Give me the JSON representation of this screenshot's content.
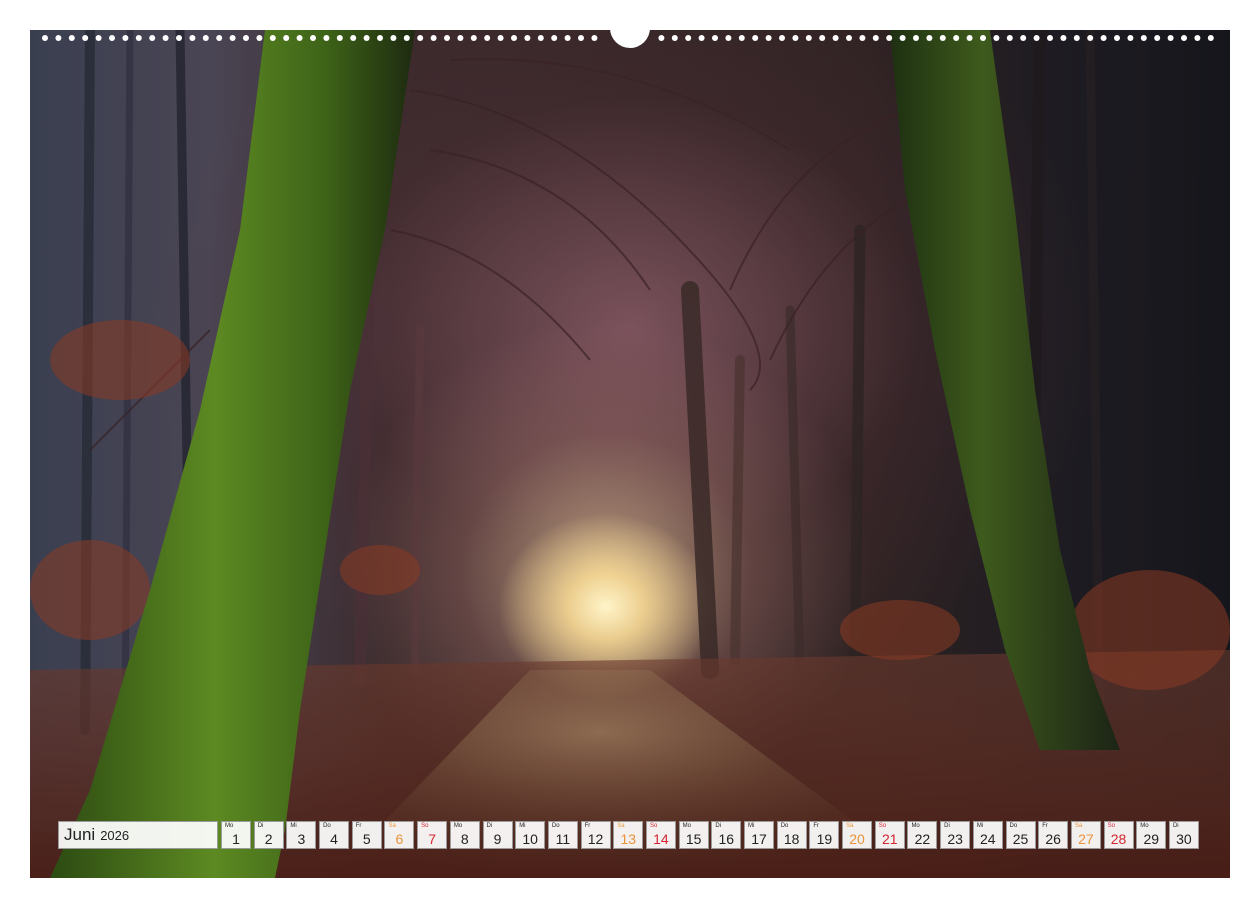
{
  "calendar": {
    "month": "Juni",
    "year": "2026",
    "colors": {
      "saturday": "#e9943a",
      "sunday": "#d42630",
      "weekday": "#222222"
    },
    "days": [
      {
        "num": "1",
        "wd": "Mo",
        "type": "wk"
      },
      {
        "num": "2",
        "wd": "Di",
        "type": "wk"
      },
      {
        "num": "3",
        "wd": "Mi",
        "type": "wk"
      },
      {
        "num": "4",
        "wd": "Do",
        "type": "wk"
      },
      {
        "num": "5",
        "wd": "Fr",
        "type": "wk"
      },
      {
        "num": "6",
        "wd": "Sa",
        "type": "sat"
      },
      {
        "num": "7",
        "wd": "So",
        "type": "sun"
      },
      {
        "num": "8",
        "wd": "Mo",
        "type": "wk"
      },
      {
        "num": "9",
        "wd": "Di",
        "type": "wk"
      },
      {
        "num": "10",
        "wd": "Mi",
        "type": "wk"
      },
      {
        "num": "11",
        "wd": "Do",
        "type": "wk"
      },
      {
        "num": "12",
        "wd": "Fr",
        "type": "wk"
      },
      {
        "num": "13",
        "wd": "Sa",
        "type": "sat"
      },
      {
        "num": "14",
        "wd": "So",
        "type": "sun"
      },
      {
        "num": "15",
        "wd": "Mo",
        "type": "wk"
      },
      {
        "num": "16",
        "wd": "Di",
        "type": "wk"
      },
      {
        "num": "17",
        "wd": "Mi",
        "type": "wk"
      },
      {
        "num": "18",
        "wd": "Do",
        "type": "wk"
      },
      {
        "num": "19",
        "wd": "Fr",
        "type": "wk"
      },
      {
        "num": "20",
        "wd": "Sa",
        "type": "sat"
      },
      {
        "num": "21",
        "wd": "So",
        "type": "sun"
      },
      {
        "num": "22",
        "wd": "Mo",
        "type": "wk"
      },
      {
        "num": "23",
        "wd": "Di",
        "type": "wk"
      },
      {
        "num": "24",
        "wd": "Mi",
        "type": "wk"
      },
      {
        "num": "25",
        "wd": "Do",
        "type": "wk"
      },
      {
        "num": "26",
        "wd": "Fr",
        "type": "wk"
      },
      {
        "num": "27",
        "wd": "Sa",
        "type": "sat"
      },
      {
        "num": "28",
        "wd": "So",
        "type": "sun"
      },
      {
        "num": "29",
        "wd": "Mo",
        "type": "wk"
      },
      {
        "num": "30",
        "wd": "Di",
        "type": "wk"
      }
    ]
  },
  "photo": {
    "subject": "forest-path-photo",
    "colors": {
      "moss": "#4f7a1e",
      "leaves": "#7a3422",
      "glow": "#fff2c4"
    }
  }
}
